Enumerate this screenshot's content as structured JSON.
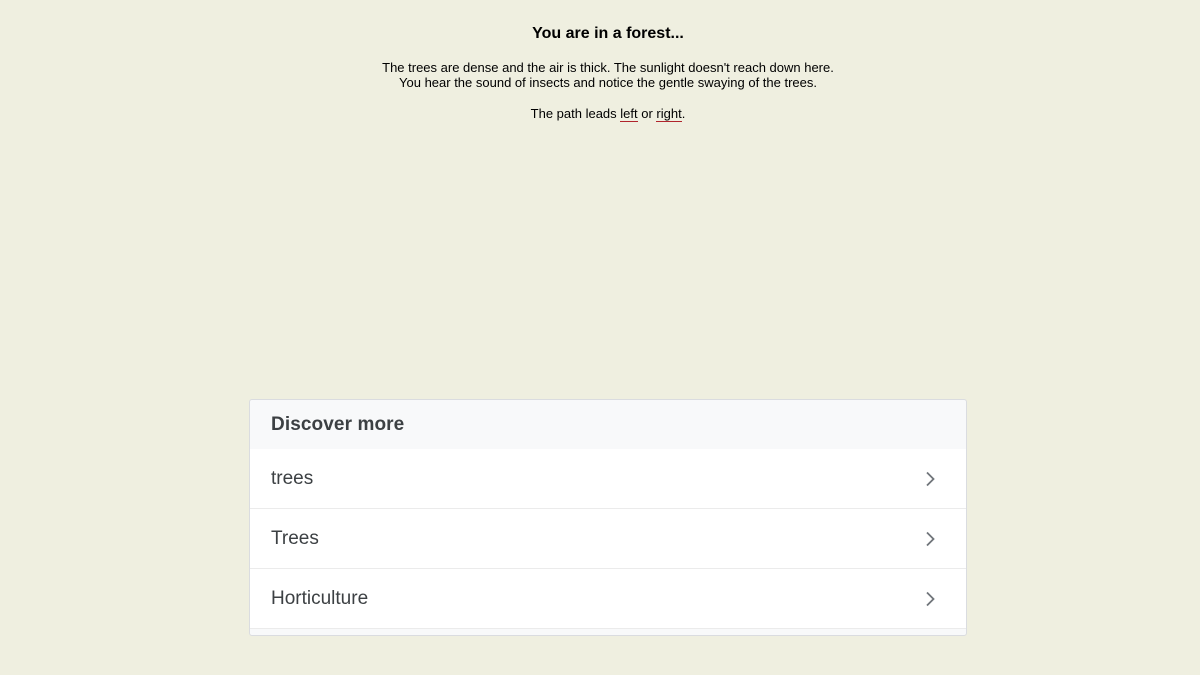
{
  "story": {
    "title": "You are in a forest...",
    "description_line1": "The trees are dense and the air is thick. The sunlight doesn't reach down here.",
    "description_line2": "You hear the sound of insects and notice the gentle swaying of the trees.",
    "path_prefix": "The path leads ",
    "left_link": "left",
    "path_middle": " or ",
    "right_link": "right",
    "path_suffix": "."
  },
  "discover": {
    "title": "Discover more",
    "items": [
      {
        "label": "trees",
        "icon": "chevron-right-icon"
      },
      {
        "label": "Trees",
        "icon": "chevron-right-icon"
      },
      {
        "label": "Horticulture",
        "icon": "chevron-right-icon"
      }
    ]
  },
  "colors": {
    "background": "#efefe0",
    "link_underline": "#b0242c",
    "card_text": "#3c4043"
  }
}
